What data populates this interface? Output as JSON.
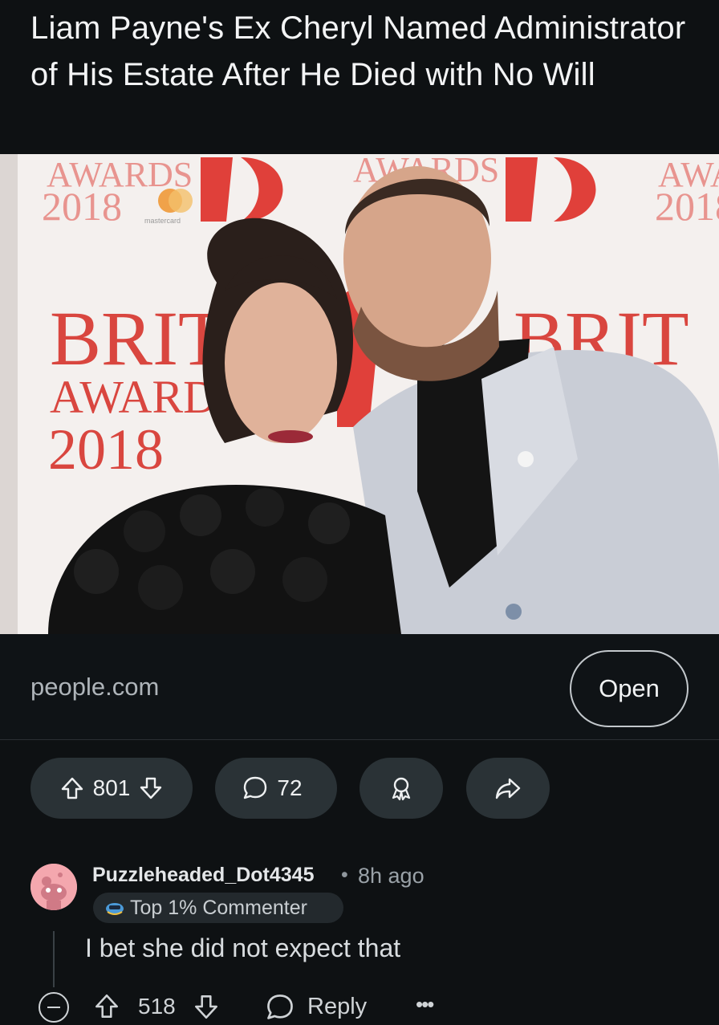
{
  "post": {
    "title": "Liam Payne's Ex Cheryl Named Administrator of His Estate After He Died with No Will",
    "link_domain": "people.com",
    "open_label": "Open",
    "image_backdrop_text": {
      "awards": "AWARDS",
      "year": "2018",
      "brand": "BRIT",
      "sponsor": "mastercard"
    }
  },
  "actions": {
    "upvotes": "801",
    "comments": "72"
  },
  "comment": {
    "username": "Puzzleheaded_Dot4345",
    "separator": "•",
    "time": "8h ago",
    "flair": "Top 1% Commenter",
    "text": "I bet she did not expect that",
    "votes": "518",
    "reply_label": "Reply",
    "more": "•••"
  },
  "colors": {
    "background": "#0e1113",
    "pill": "#2a3236",
    "brit_red": "#e0403a"
  }
}
